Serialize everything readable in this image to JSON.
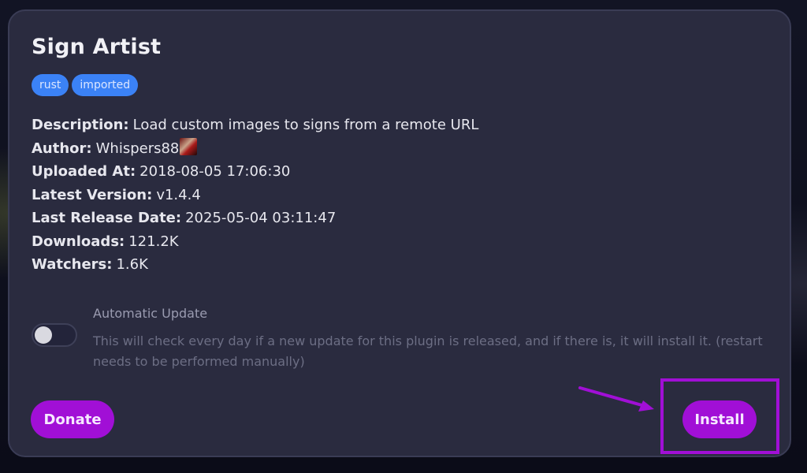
{
  "plugin": {
    "title": "Sign Artist",
    "tags": [
      "rust",
      "imported"
    ]
  },
  "details": {
    "description": {
      "label": "Description:",
      "value": "Load custom images to signs from a remote URL"
    },
    "author": {
      "label": "Author:",
      "value": "Whispers88"
    },
    "uploaded_at": {
      "label": "Uploaded At:",
      "value": "2018-08-05 17:06:30"
    },
    "latest_version": {
      "label": "Latest Version:",
      "value": "v1.4.4"
    },
    "last_release_date": {
      "label": "Last Release Date:",
      "value": "2025-05-04 03:11:47"
    },
    "downloads": {
      "label": "Downloads:",
      "value": "121.2K"
    },
    "watchers": {
      "label": "Watchers:",
      "value": "1.6K"
    }
  },
  "auto_update": {
    "label": "Automatic Update",
    "description": "This will check every day if a new update for this plugin is released, and if there is, it will install it. (restart needs to be performed manually)",
    "enabled": false
  },
  "actions": {
    "donate_label": "Donate",
    "install_label": "Install"
  },
  "colors": {
    "accent": "#a10fd6",
    "tag": "#3b82f6",
    "card": "#2a2b3f"
  }
}
